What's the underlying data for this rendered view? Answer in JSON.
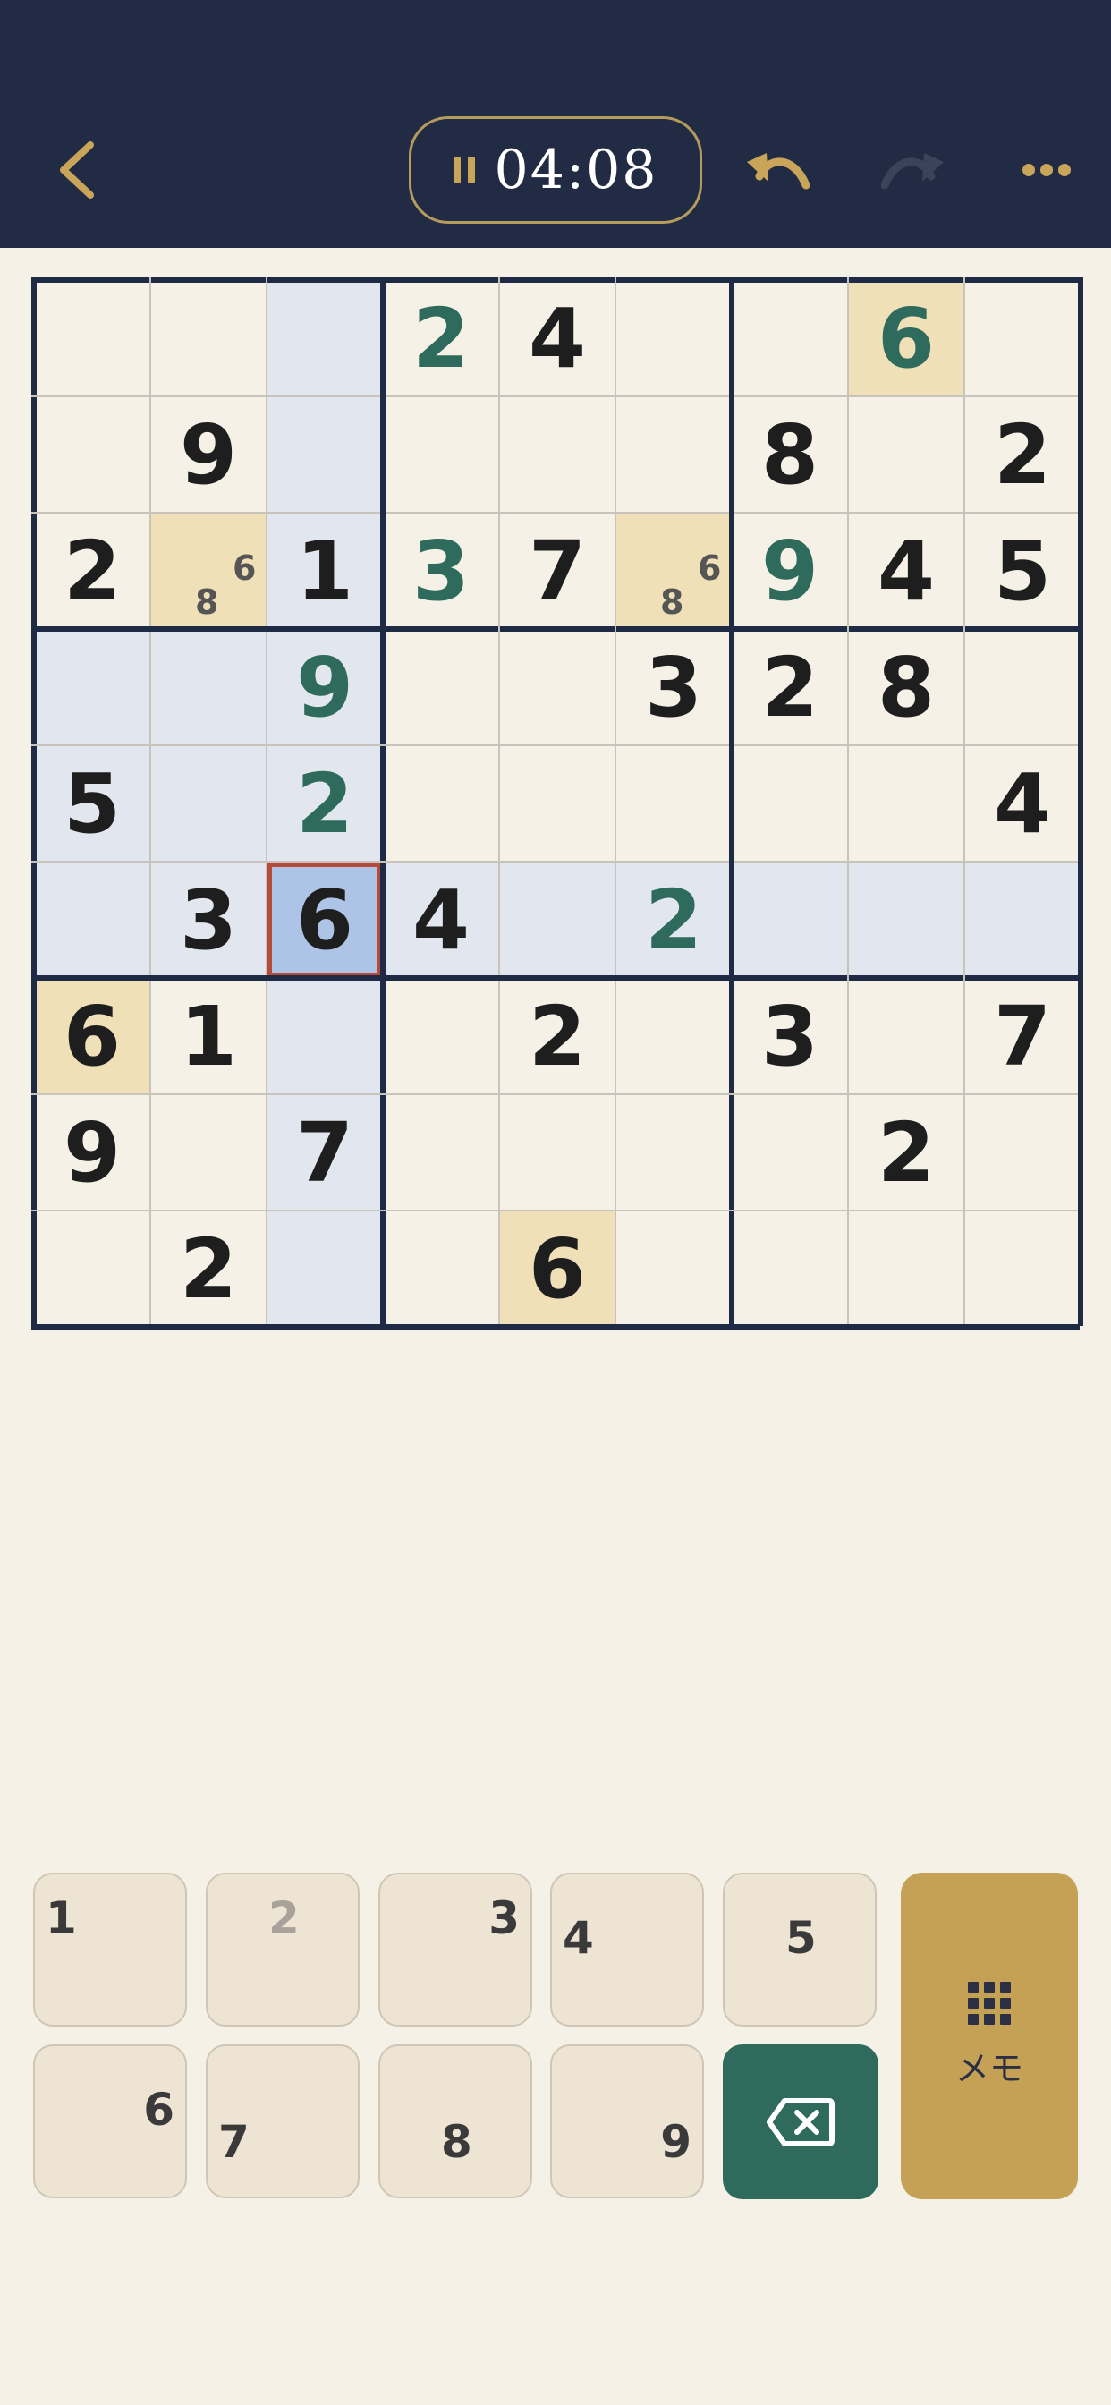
{
  "header": {
    "timer": "04:08",
    "icons": {
      "back": "chevron-left-icon",
      "pause": "pause-icon",
      "undo": "undo-icon",
      "redo": "redo-icon",
      "more": "more-horizontal-icon"
    },
    "colors": {
      "background": "#222b44",
      "accent": "#c9a55a",
      "redo_disabled": "#3a4358"
    }
  },
  "board": {
    "givens": [
      [
        0,
        0,
        0,
        0,
        4,
        0,
        0,
        0,
        0
      ],
      [
        0,
        9,
        0,
        0,
        0,
        0,
        8,
        0,
        2
      ],
      [
        2,
        0,
        1,
        0,
        7,
        0,
        0,
        4,
        5
      ],
      [
        0,
        0,
        0,
        0,
        0,
        3,
        2,
        8,
        0
      ],
      [
        5,
        0,
        0,
        0,
        0,
        0,
        0,
        0,
        4
      ],
      [
        0,
        3,
        6,
        4,
        0,
        0,
        0,
        0,
        0
      ],
      [
        6,
        1,
        0,
        0,
        2,
        0,
        3,
        0,
        7
      ],
      [
        9,
        0,
        7,
        0,
        0,
        0,
        0,
        2,
        0
      ],
      [
        0,
        2,
        0,
        0,
        6,
        0,
        0,
        0,
        0
      ]
    ],
    "entries": [
      [
        0,
        0,
        0,
        2,
        0,
        0,
        0,
        6,
        0
      ],
      [
        0,
        0,
        0,
        0,
        0,
        0,
        0,
        0,
        0
      ],
      [
        0,
        0,
        0,
        3,
        0,
        0,
        9,
        0,
        0
      ],
      [
        0,
        0,
        9,
        0,
        0,
        0,
        0,
        0,
        0
      ],
      [
        0,
        0,
        2,
        0,
        0,
        0,
        0,
        0,
        0
      ],
      [
        0,
        0,
        0,
        0,
        0,
        2,
        0,
        0,
        0
      ],
      [
        0,
        0,
        0,
        0,
        0,
        0,
        0,
        0,
        0
      ],
      [
        0,
        0,
        0,
        0,
        0,
        0,
        0,
        0,
        0
      ],
      [
        0,
        0,
        0,
        0,
        0,
        0,
        0,
        0,
        0
      ]
    ],
    "notes": [
      {
        "row": 2,
        "col": 1,
        "digits": [
          6,
          8
        ]
      },
      {
        "row": 2,
        "col": 5,
        "digits": [
          6,
          8
        ]
      }
    ],
    "selected": {
      "row": 5,
      "col": 2
    },
    "highlight_value": 6,
    "colors": {
      "given": "#1e1e1e",
      "user": "#2e6b5c",
      "peer": "#e2e6ee",
      "same_value": "#efe0b8",
      "selected": "#aec4e6",
      "selected_border": "#b5493a"
    }
  },
  "keypad": {
    "keys": [
      {
        "label": "1",
        "completed": false
      },
      {
        "label": "2",
        "completed": true
      },
      {
        "label": "3",
        "completed": false
      },
      {
        "label": "4",
        "completed": false
      },
      {
        "label": "5",
        "completed": false
      },
      {
        "label": "6",
        "completed": false
      },
      {
        "label": "7",
        "completed": false
      },
      {
        "label": "8",
        "completed": false
      },
      {
        "label": "9",
        "completed": false
      }
    ],
    "erase_icon": "backspace-icon",
    "memo": {
      "icon": "grid-icon",
      "label": "メモ"
    },
    "colors": {
      "erase": "#2f6b5d",
      "memo": "#c4a155"
    }
  }
}
